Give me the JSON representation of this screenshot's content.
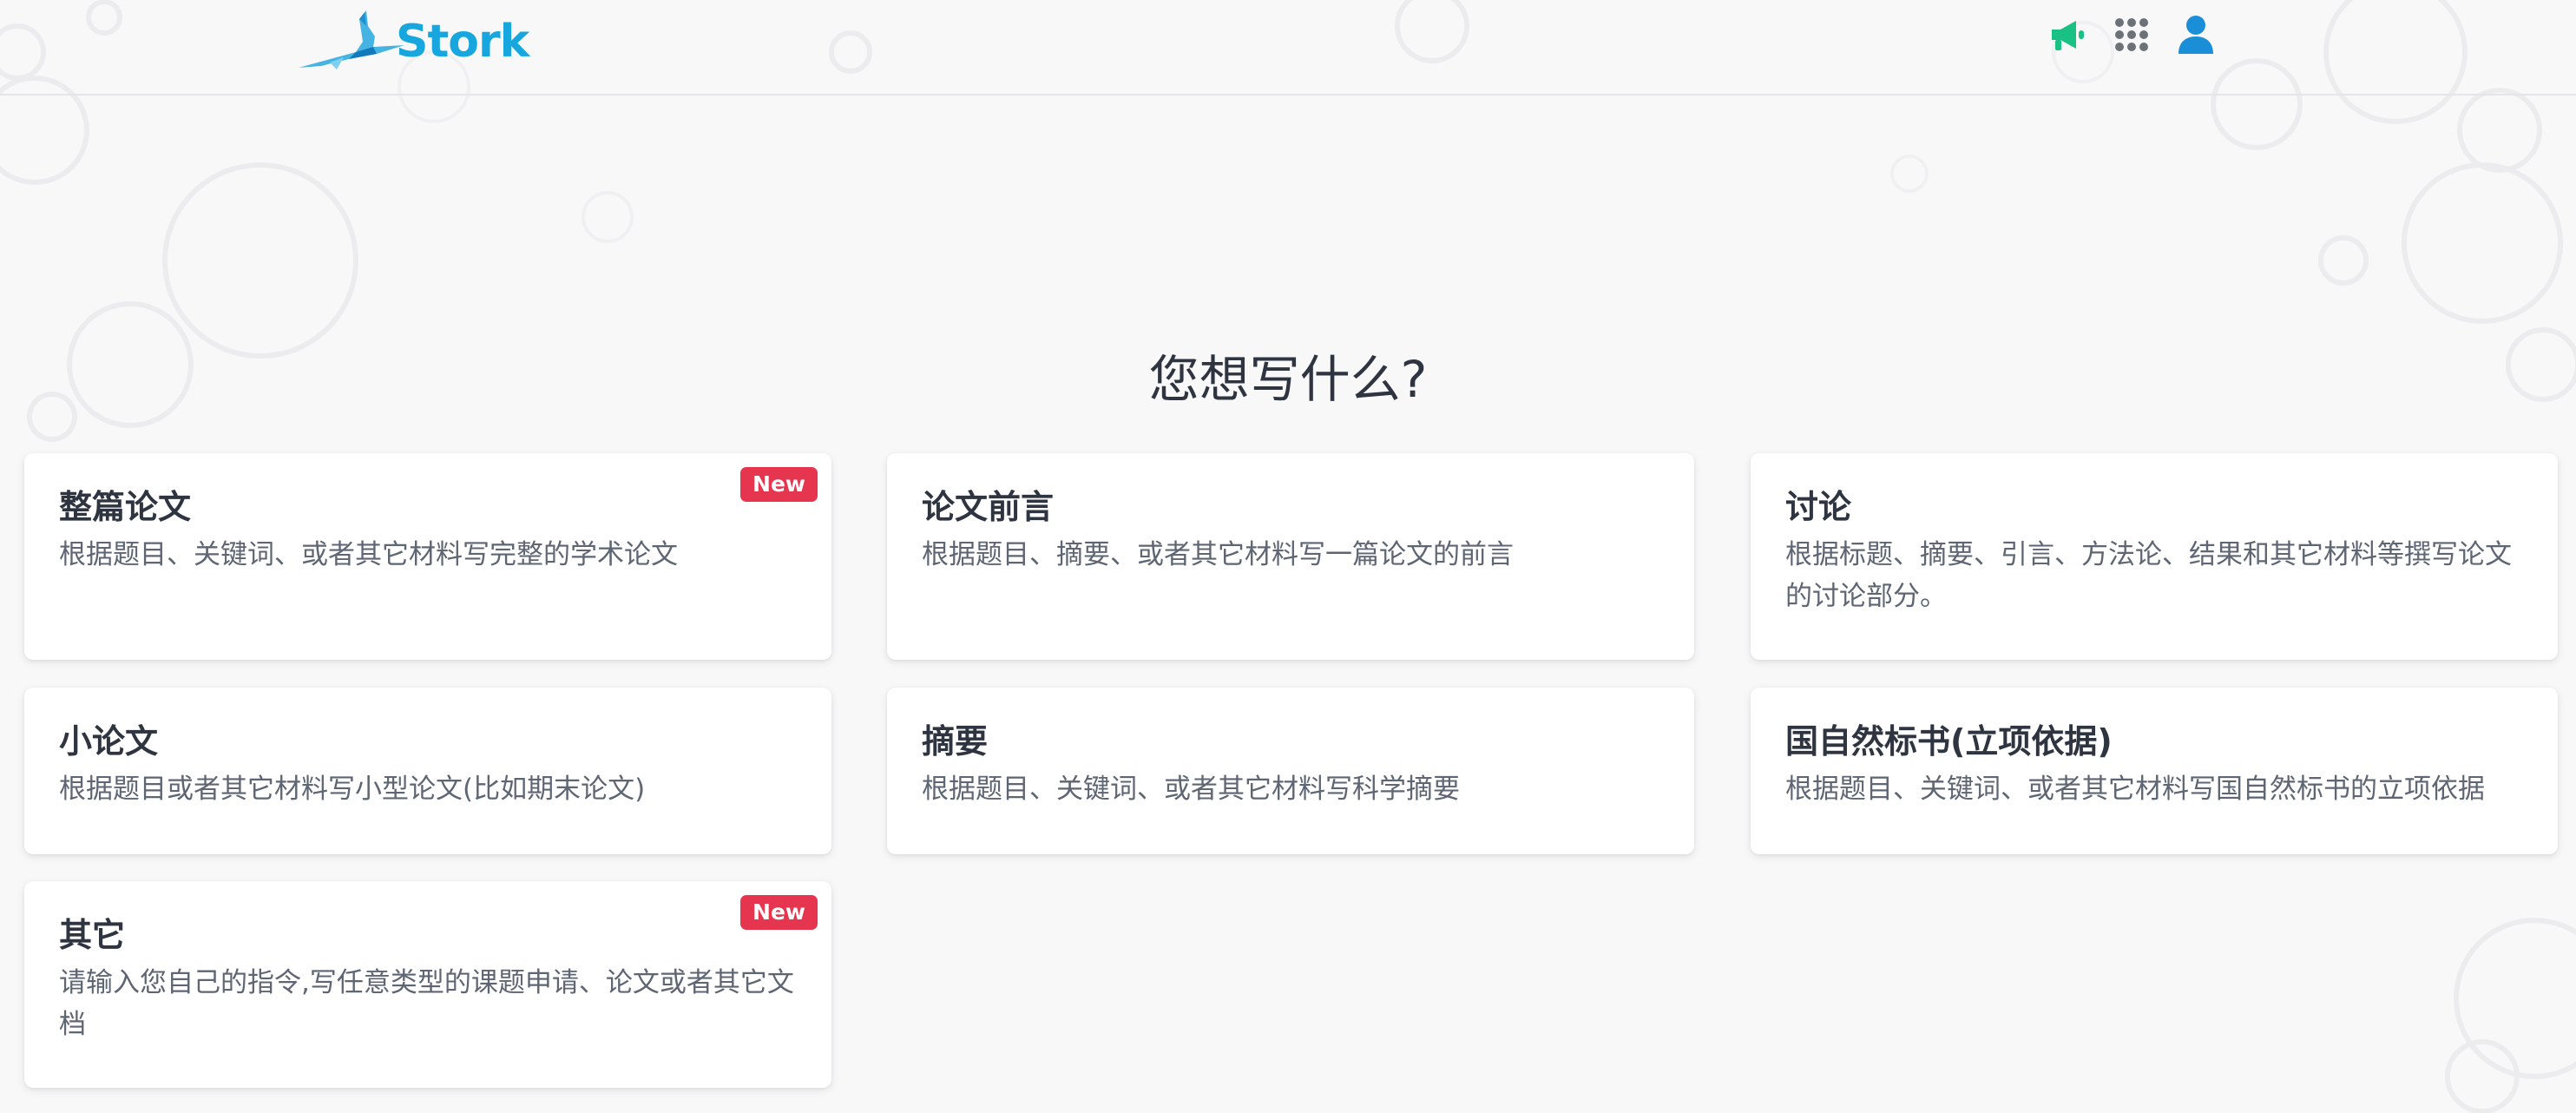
{
  "header": {
    "logo_text": "Stork",
    "icons": [
      "megaphone-icon",
      "apps-grid-icon",
      "user-icon"
    ]
  },
  "main": {
    "title": "您想写什么?",
    "cards": [
      {
        "title": "整篇论文",
        "desc": "根据题目、关键词、或者其它材料写完整的学术论文",
        "badge": "New"
      },
      {
        "title": "论文前言",
        "desc": "根据题目、摘要、或者其它材料写一篇论文的前言",
        "badge": ""
      },
      {
        "title": "讨论",
        "desc": "根据标题、摘要、引言、方法论、结果和其它材料等撰写论文的讨论部分。",
        "badge": ""
      },
      {
        "title": "小论文",
        "desc": "根据题目或者其它材料写小型论文(比如期末论文)",
        "badge": ""
      },
      {
        "title": "摘要",
        "desc": "根据题目、关键词、或者其它材料写科学摘要",
        "badge": ""
      },
      {
        "title": "国自然标书(立项依据)",
        "desc": "根据题目、关键词、或者其它材料写国自然标书的立项依据",
        "badge": ""
      },
      {
        "title": "其它",
        "desc": "请输入您自己的指令,写任意类型的课题申请、论文或者其它文档",
        "badge": "New"
      }
    ]
  },
  "colors": {
    "brand": "#17a6dd",
    "megaphone": "#19c184",
    "badge": "#e5354f",
    "background": "#f8f8f9"
  }
}
